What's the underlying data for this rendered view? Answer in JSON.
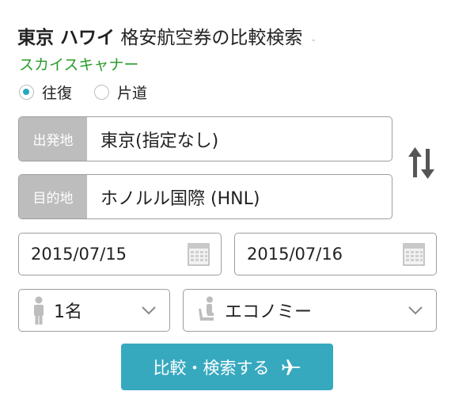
{
  "header": {
    "title_bold": "東京 ハワイ",
    "title_rest": "格安航空券の比較検索",
    "title_dash": "-",
    "subtitle": "スカイスキャナー"
  },
  "trip_type": {
    "options": [
      {
        "label": "往復",
        "selected": true
      },
      {
        "label": "片道",
        "selected": false
      }
    ]
  },
  "origin": {
    "label": "出発地",
    "value": "東京(指定なし)"
  },
  "destination": {
    "label": "目的地",
    "value": "ホノルル国際 (HNL)"
  },
  "dates": {
    "depart": "2015/07/15",
    "return": "2015/07/16"
  },
  "passengers": {
    "value": "1名"
  },
  "cabin_class": {
    "value": "エコノミー"
  },
  "search_button": {
    "label": "比較・検索する"
  },
  "colors": {
    "accent": "#37a9bf",
    "brand_green": "#2a9d2a",
    "label_gray": "#bdbdbd"
  },
  "icons": [
    "swap-arrows-icon",
    "calendar-icon",
    "person-icon",
    "seat-icon",
    "chevron-down-icon",
    "airplane-icon"
  ]
}
